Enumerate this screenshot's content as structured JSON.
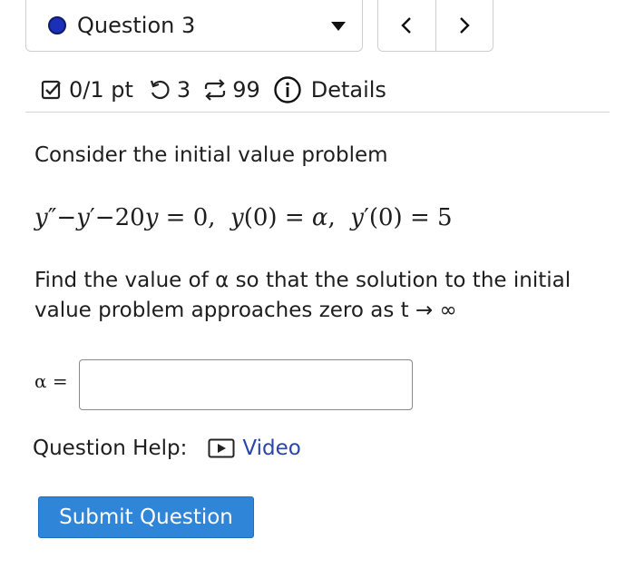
{
  "question_selector": {
    "label": "Question 3",
    "status_color": "#1b2fb8"
  },
  "nav": {
    "prev_label": "<",
    "next_label": ">"
  },
  "status_bar": {
    "score": "0/1 pt",
    "retries": "3",
    "attempts": "99",
    "details_label": "Details"
  },
  "question": {
    "intro": "Consider the initial value problem",
    "equation": "y″−y′−20y = 0,  y(0) = α,  y′(0) = 5",
    "prompt_line1": "Find the value of α so that the solution to the initial",
    "prompt_line2": "value problem approaches zero as t → ∞"
  },
  "answer": {
    "label": "α =",
    "value": "",
    "placeholder": ""
  },
  "help": {
    "label": "Question Help:",
    "video_label": "Video"
  },
  "submit_label": "Submit Question",
  "colors": {
    "accent": "#2f86d9",
    "link": "#2b45a8"
  }
}
